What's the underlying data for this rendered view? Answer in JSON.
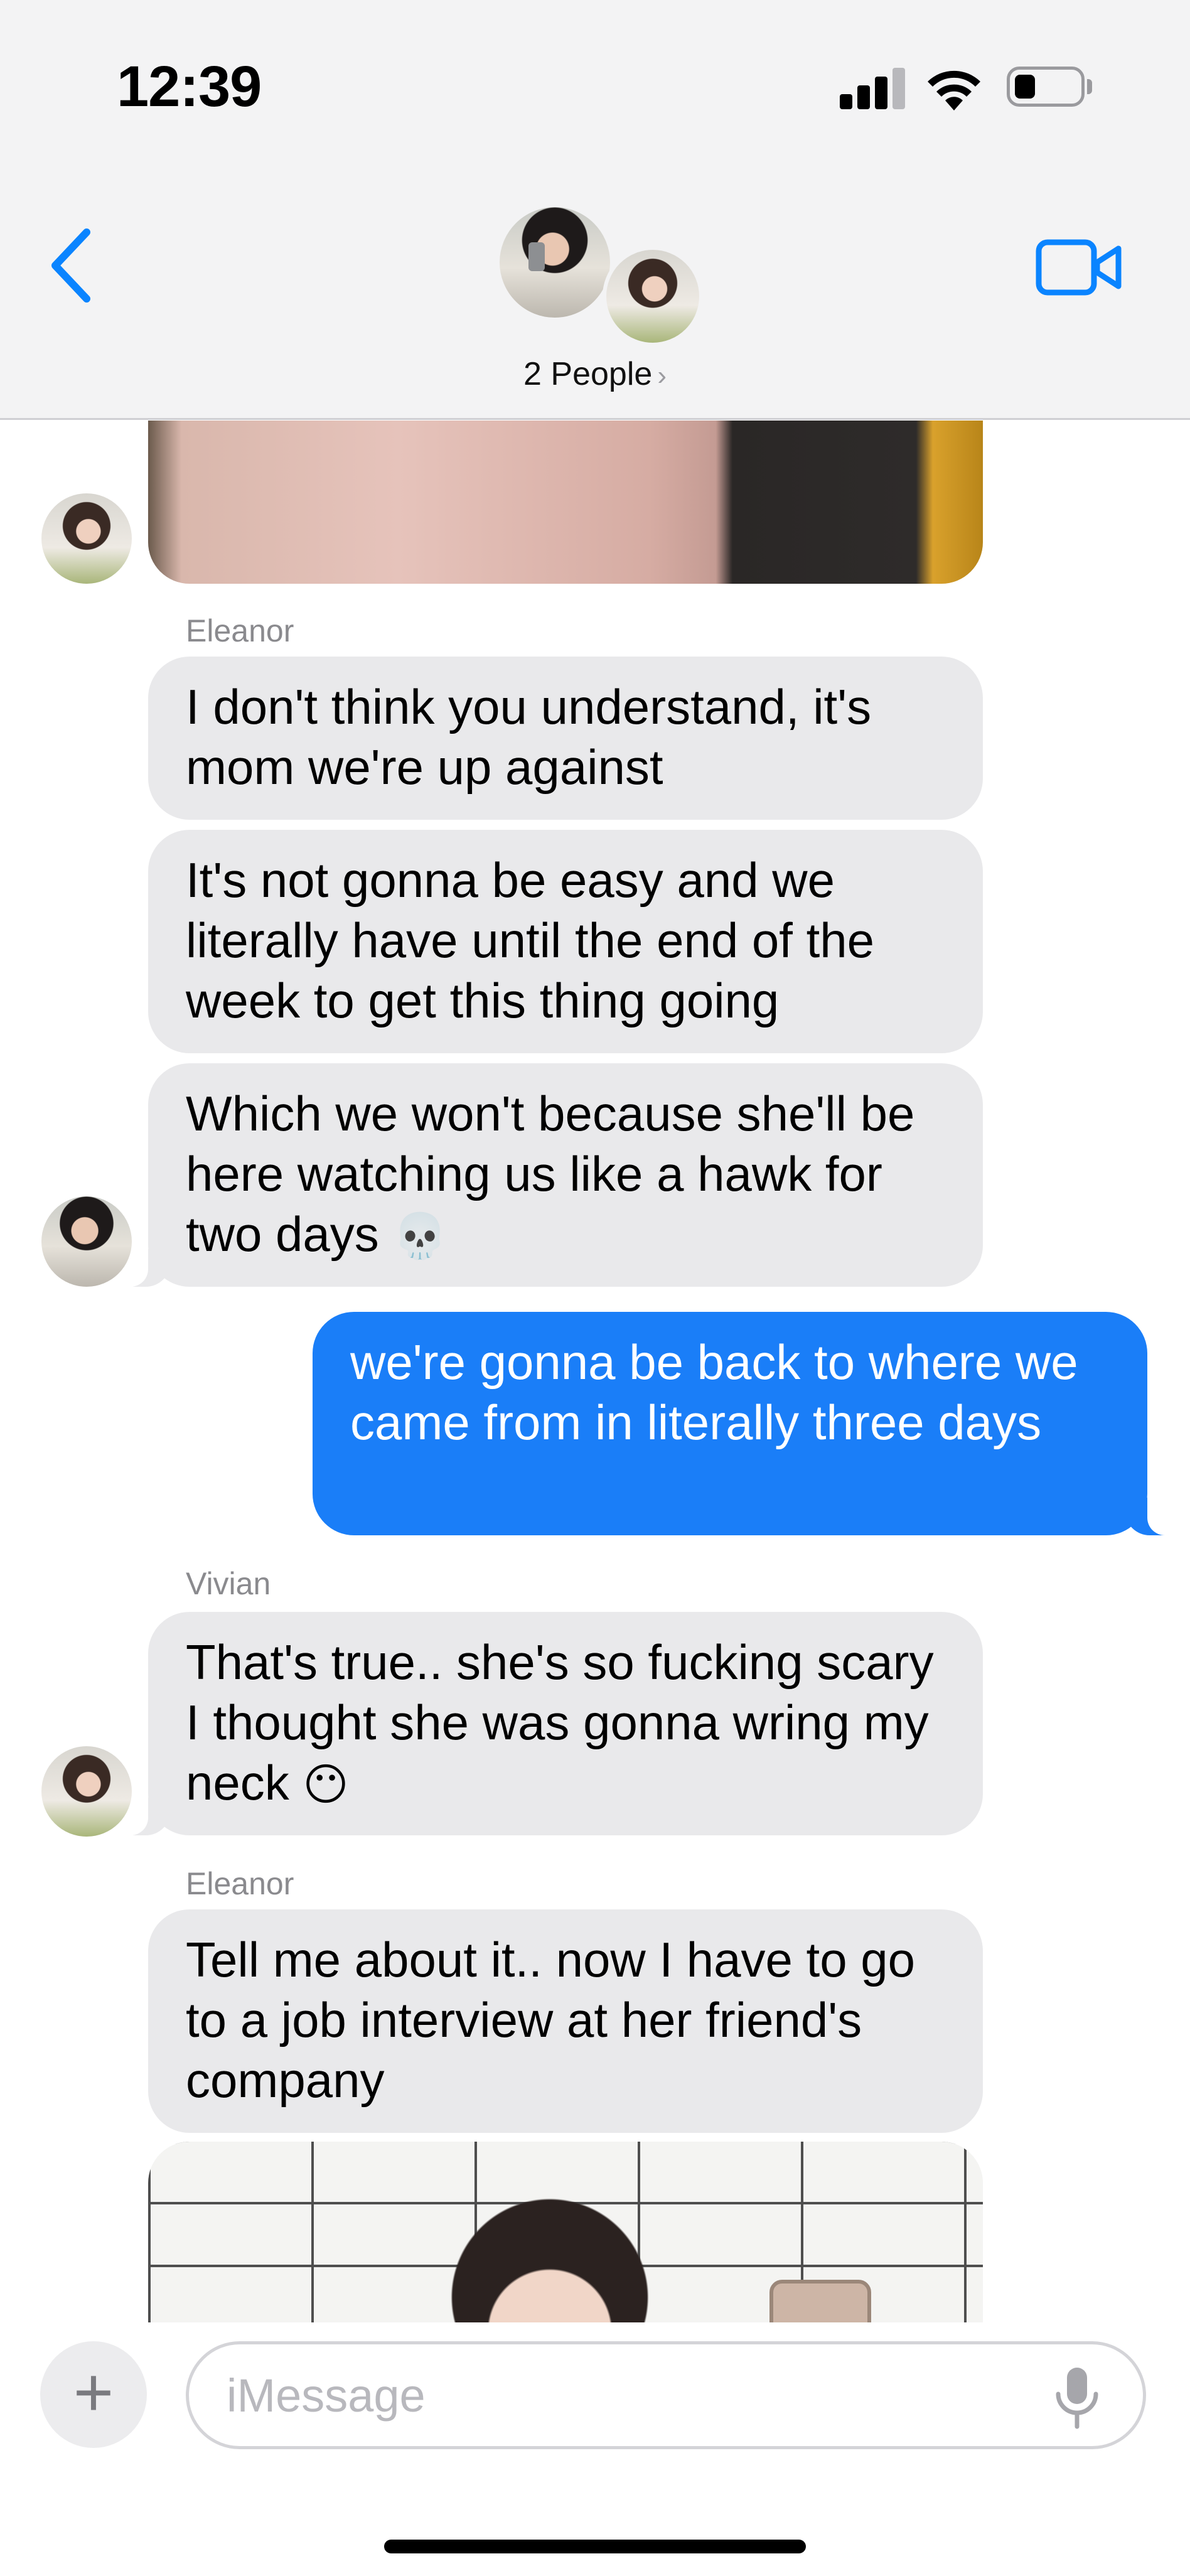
{
  "status_bar": {
    "time": "12:39"
  },
  "header": {
    "people_label": "2 People",
    "chevron": "›"
  },
  "messages": [
    {
      "sender": "Eleanor",
      "text": "I don't think you understand, it's mom we're up against"
    },
    {
      "text": "It's not gonna be easy and we literally have until the end of the week to get this thing going"
    },
    {
      "text": "Which we won't because she'll be here watching us like a hawk for two days",
      "emoji": "💀"
    },
    {
      "text": "we're gonna be back to where we came from in literally three days"
    },
    {
      "sender": "Vivian",
      "text": "That's true.. she's so fucking scary I thought she was gonna wring my neck",
      "emoji": "😶"
    },
    {
      "sender": "Eleanor",
      "text": "Tell me about it.. now I have to go to a job interview at her friend's company"
    }
  ],
  "input": {
    "placeholder": "iMessage",
    "plus": "+"
  },
  "colors": {
    "outgoing": "#1a7ef8",
    "incoming": "#e9e9eb",
    "accent": "#0a84ff"
  }
}
